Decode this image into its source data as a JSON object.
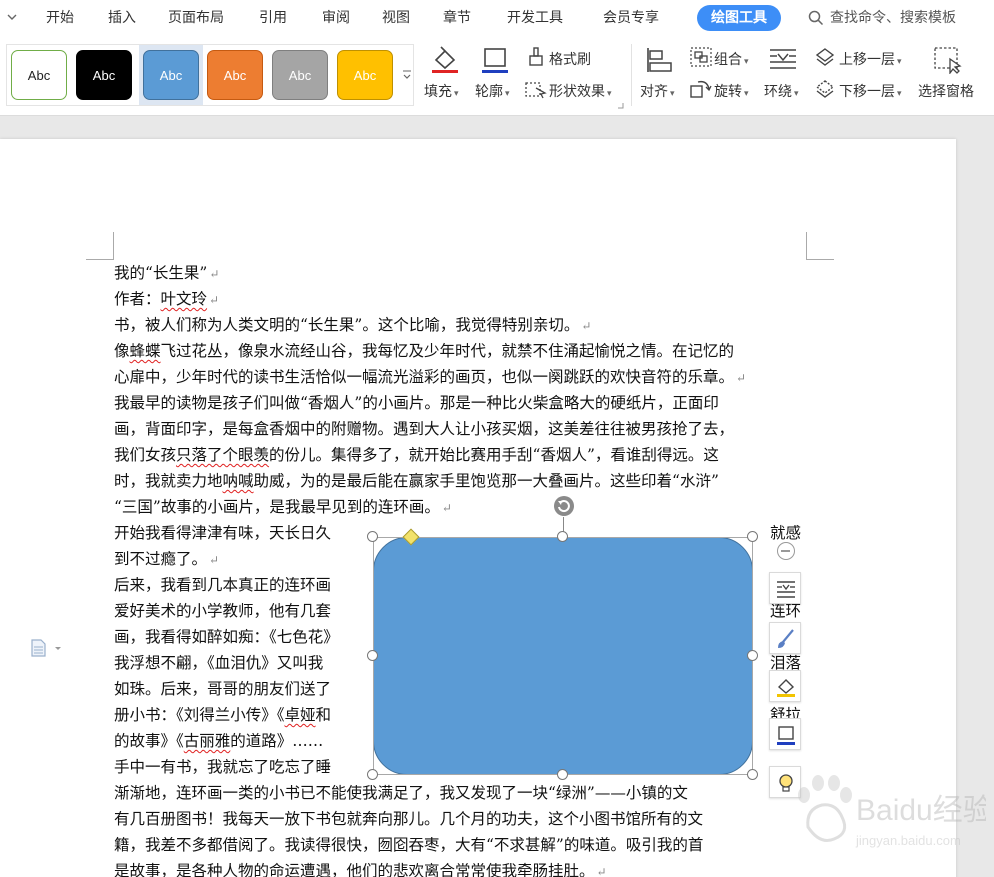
{
  "menu": {
    "items": [
      "开始",
      "插入",
      "页面布局",
      "引用",
      "审阅",
      "视图",
      "章节",
      "开发工具",
      "会员专享"
    ],
    "active": "绘图工具",
    "search_text": "查找命令、搜索模板"
  },
  "ribbon": {
    "style_swatches": [
      {
        "label": "Abc",
        "fill": "#ffffff",
        "border": "#70ad47",
        "text": "#222222"
      },
      {
        "label": "Abc",
        "fill": "#000000",
        "border": "#000000",
        "text": "#ffffff"
      },
      {
        "label": "Abc",
        "fill": "#5b9bd5",
        "border": "#41719c",
        "text": "#ffffff"
      },
      {
        "label": "Abc",
        "fill": "#ed7d31",
        "border": "#c55a11",
        "text": "#ffffff"
      },
      {
        "label": "Abc",
        "fill": "#a5a5a5",
        "border": "#7f7f7f",
        "text": "#ffffff"
      },
      {
        "label": "Abc",
        "fill": "#ffc000",
        "border": "#bf9000",
        "text": "#ffffff"
      }
    ],
    "fill": "填充",
    "outline": "轮廓",
    "format_painter": "格式刷",
    "shape_effect": "形状效果",
    "align": "对齐",
    "group": "组合",
    "rotate": "旋转",
    "wrap": "环绕",
    "bring_forward": "上移一层",
    "send_backward": "下移一层",
    "selection_pane": "选择窗格"
  },
  "document": {
    "lines": [
      "我的“长生果”",
      "作者：叶文玲",
      "书，被人们称为人类文明的“长生果”。这个比喻，我觉得特别亲切。",
      "像蜂蝶飞过花丛，像泉水流经山谷，我每忆及少年时代，就禁不住涌起愉悦之情。在记忆的",
      "心扉中，少年时代的读书生活恰似一幅流光溢彩的画页，也似一阕跳跃的欢快音符的乐章。",
      "我最早的读物是孩子们叫做“香烟人”的小画片。那是一种比火柴盒略大的硬纸片，正面印",
      "画，背面印字，是每盒香烟中的附赠物。遇到大人让小孩买烟，这美差往往被男孩抢了去，",
      "我们女孩只落了个眼羡的份儿。集得多了，就开始比赛用手刮“香烟人”，看谁刮得远。这",
      "时，我就卖力地呐喊助威，为的是最后能在赢家手里饱览那一大叠画片。这些印着“水浒”",
      "“三国”故事的小画片，是我最早见到的连环画。"
    ],
    "wrapped_left": [
      "开始我看得津津有味，天长日久",
      "到不过瘾了。",
      "后来，我看到几本真正的连环画",
      "爱好美术的小学教师，他有几套",
      "画，我看得如醉如痴：《七色花》",
      "我浮想不翩，《血泪仇》又叫我",
      "如珠。后来，哥哥的朋友们送了",
      "册小书：《刘得兰小传》《卓娅和",
      "的故事》《古丽雅的道路》……",
      "手中一有书，我就忘了吃忘了睡"
    ],
    "wrapped_right": [
      "就感",
      "连环",
      "泪落",
      "舒拉"
    ],
    "bottom_lines": [
      "渐渐地，连环画一类的小书已不能使我满足了，我又发现了一块“绿洲”——小镇的文",
      "有几百册图书！我每天一放下书包就奔向那儿。几个月的功夫，这个小图书馆所有的文",
      "籍，我差不多都借阅了。我读得很快，囫囵吞枣，大有“不求甚解”的味道。吸引我的首",
      "是故事，是各种人物的命运遭遇，他们的悲欢离合常常使我牵肠挂肚。"
    ]
  },
  "shape": {
    "fill": "#5b9bd5",
    "border": "#41719c"
  },
  "watermark": {
    "text": "Baidu经验",
    "sub": "jingyan.baidu.com"
  }
}
